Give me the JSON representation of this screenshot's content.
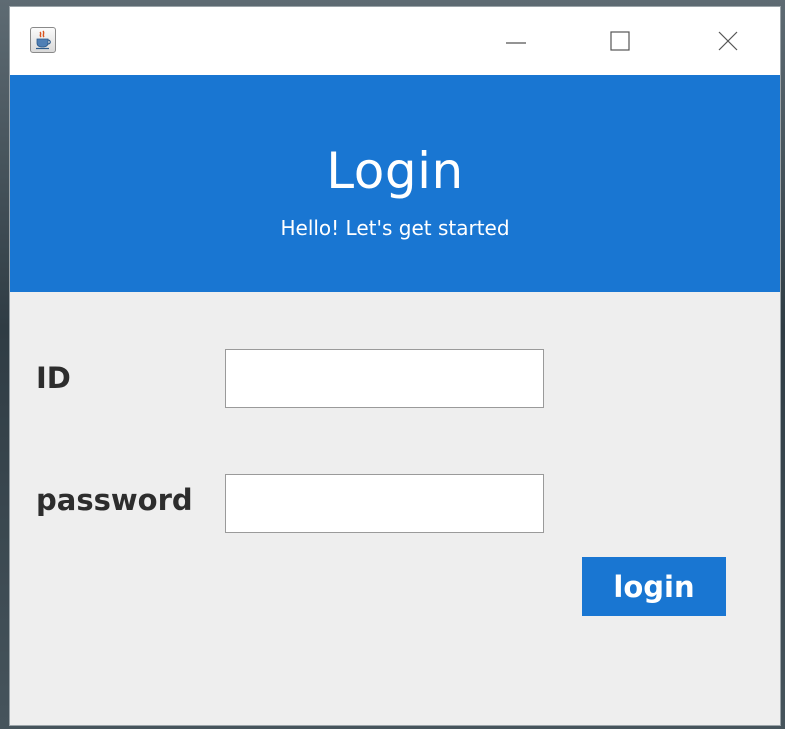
{
  "window": {
    "app_icon": "java-coffee-cup-icon",
    "controls": {
      "minimize_icon": "minimize-icon",
      "maximize_icon": "maximize-icon",
      "close_icon": "close-icon"
    }
  },
  "header": {
    "title": "Login",
    "subtitle": "Hello! Let's get started",
    "background_color": "#1976d2"
  },
  "form": {
    "id_label": "ID",
    "id_value": "",
    "password_label": "password",
    "password_value": "",
    "login_button_label": "login",
    "button_color": "#1976d2"
  }
}
